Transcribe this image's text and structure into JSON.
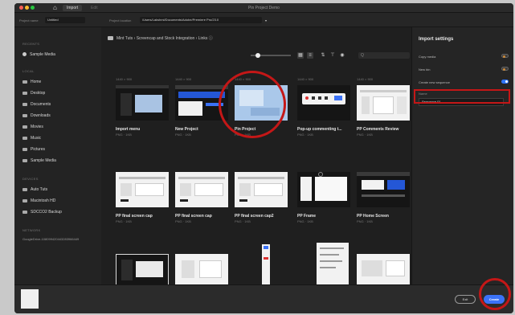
{
  "window": {
    "title": "Pin Project Demo",
    "home_icon": "home-icon"
  },
  "tabs": [
    {
      "label": "Import"
    },
    {
      "label": "Edit"
    }
  ],
  "options_bar": {
    "project_name_label": "Project name",
    "project_name_value": "Untitled",
    "location_label": "Project location",
    "location_value": "/Users/Lakshmi/Documents/Adobe/Premiere Pro/23.0"
  },
  "sidebar": {
    "sections": {
      "recents": "RECENTS",
      "local": "LOCAL",
      "devices": "DEVICES",
      "network": "NETWORK"
    },
    "recents": [
      {
        "label": "Sample Media"
      }
    ],
    "local": [
      {
        "label": "Home"
      },
      {
        "label": "Desktop"
      },
      {
        "label": "Documents"
      },
      {
        "label": "Downloads"
      },
      {
        "label": "Movies"
      },
      {
        "label": "Music"
      },
      {
        "label": "Pictures"
      },
      {
        "label": "Sample Media"
      }
    ],
    "devices": [
      {
        "label": "Auto Tuts"
      },
      {
        "label": "Macintosh HD"
      },
      {
        "label": "SDCCO2 Backup"
      }
    ],
    "network": [
      {
        "label": "GoogleDrive-108099420443283966449"
      }
    ]
  },
  "breadcrumb": {
    "path": "Mint Tuts  ›  Screencap and Stock Integration  ›  Links  ⓘ"
  },
  "search": {
    "placeholder": "Q"
  },
  "row1_meta": [
    "1440 × 900",
    "1440 × 900",
    "1440 × 900",
    "1440 × 900",
    "1440 × 900"
  ],
  "cards": [
    {
      "title": "Import menu",
      "meta": "PNG · 1KB"
    },
    {
      "title": "New Project",
      "meta": "PNG · 1KB"
    },
    {
      "title": "Pin Project",
      "meta": "PNG · 1KB"
    },
    {
      "title": "Pop-up commenting t...",
      "meta": "PNG · 1KB"
    },
    {
      "title": "PP Comments Review",
      "meta": "PNG · 1KB"
    },
    {
      "title": "PP final screen cap",
      "meta": "PNG · 1KB"
    },
    {
      "title": "PP final screen cap",
      "meta": "PNG · 1KB"
    },
    {
      "title": "PP final screen cap2",
      "meta": "PNG · 1KB"
    },
    {
      "title": "PP Frame",
      "meta": "PNG · 1KB"
    },
    {
      "title": "PP Home Screen",
      "meta": "PNG · 1KB"
    }
  ],
  "import_settings": {
    "title": "Import settings",
    "copy_media": "Copy media",
    "new_bin": "New bin",
    "create_sequence": "Create new sequence",
    "name_label": "Name",
    "name_value": "Sequence 01",
    "copy_media_on": false,
    "new_bin_on": false,
    "create_sequence_on": true
  },
  "footer": {
    "exit_label": "Exit",
    "create_label": "Create"
  },
  "colors": {
    "accent": "#3b72f7",
    "annotation": "#c41717"
  }
}
